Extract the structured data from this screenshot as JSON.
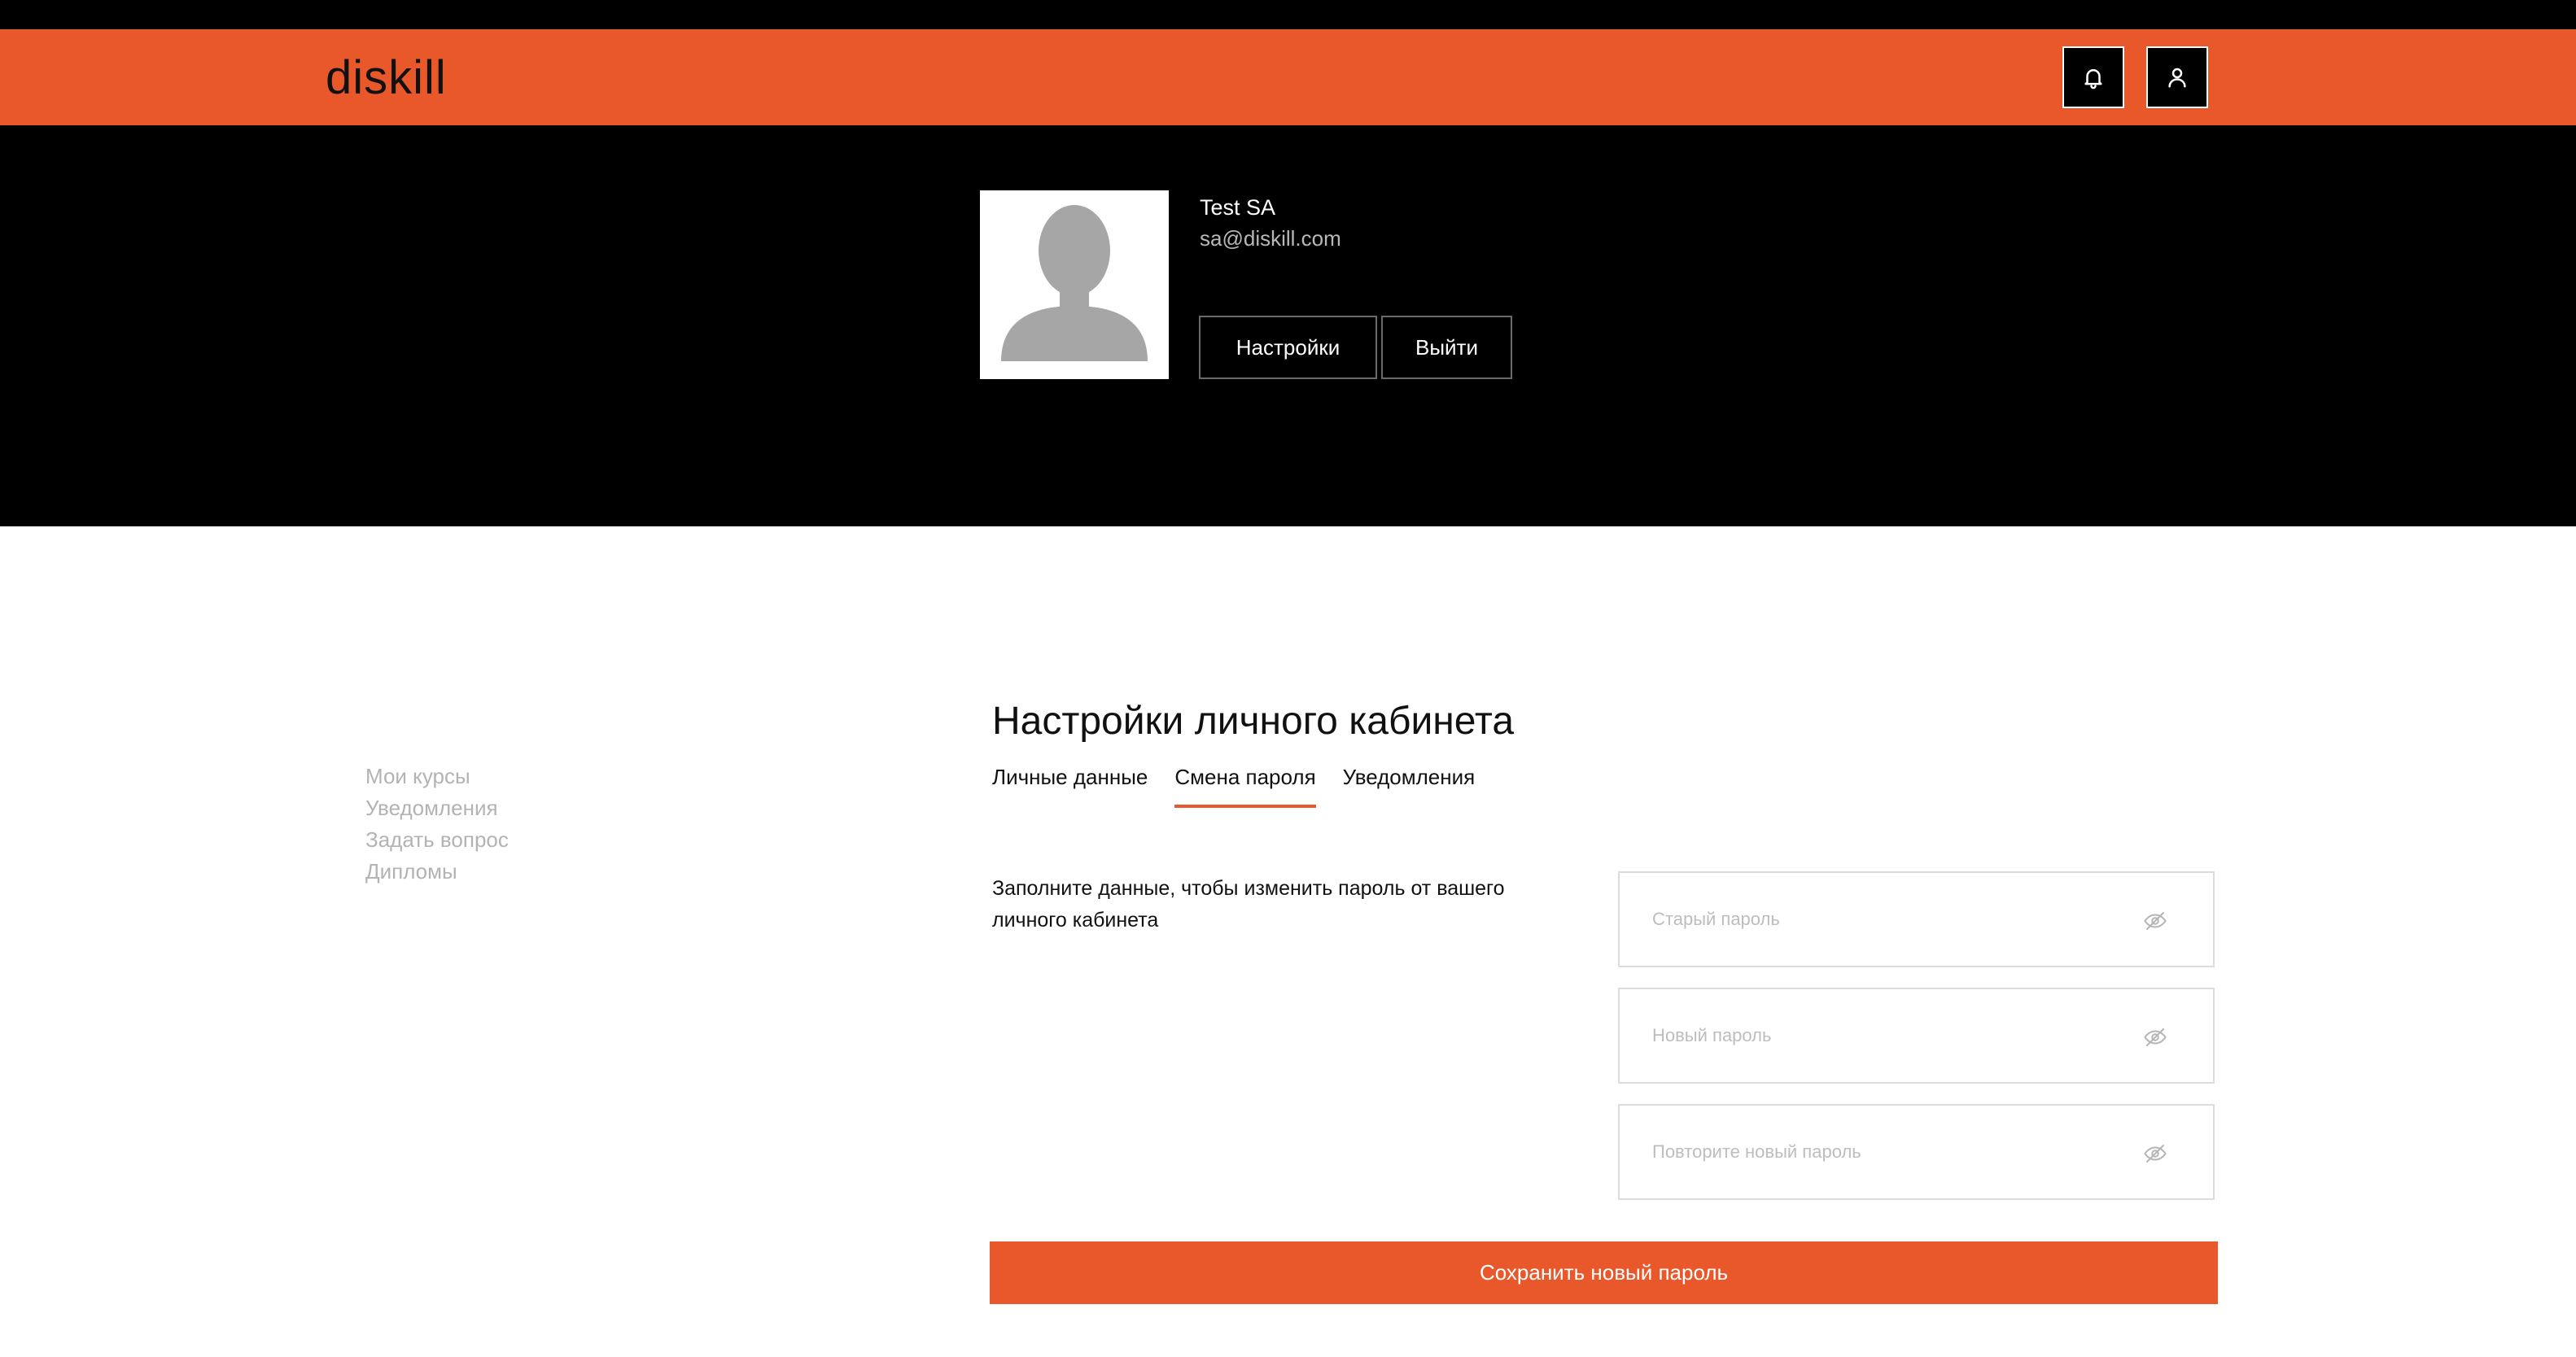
{
  "header": {
    "logo": "diskill",
    "brand_color": "#e9582a",
    "icons": [
      "bell-icon",
      "user-icon"
    ]
  },
  "profile": {
    "name": "Test SA",
    "email": "sa@diskill.com",
    "settings_label": "Настройки",
    "logout_label": "Выйти"
  },
  "sidebar": {
    "items": [
      {
        "label": "Мои курсы"
      },
      {
        "label": "Уведомления"
      },
      {
        "label": "Задать вопрос"
      },
      {
        "label": "Дипломы"
      }
    ]
  },
  "main": {
    "title": "Настройки личного кабинета",
    "tabs": [
      {
        "label": "Личные данные",
        "active": false
      },
      {
        "label": "Смена пароля",
        "active": true
      },
      {
        "label": "Уведомления",
        "active": false
      }
    ],
    "description": "Заполните данные, чтобы изменить пароль от вашего личного кабинета",
    "fields": {
      "old_password": {
        "placeholder": "Старый пароль",
        "value": ""
      },
      "new_password": {
        "placeholder": "Новый пароль",
        "value": ""
      },
      "repeat_password": {
        "placeholder": "Повторите новый пароль",
        "value": ""
      }
    },
    "save_label": "Сохранить новый пароль"
  }
}
